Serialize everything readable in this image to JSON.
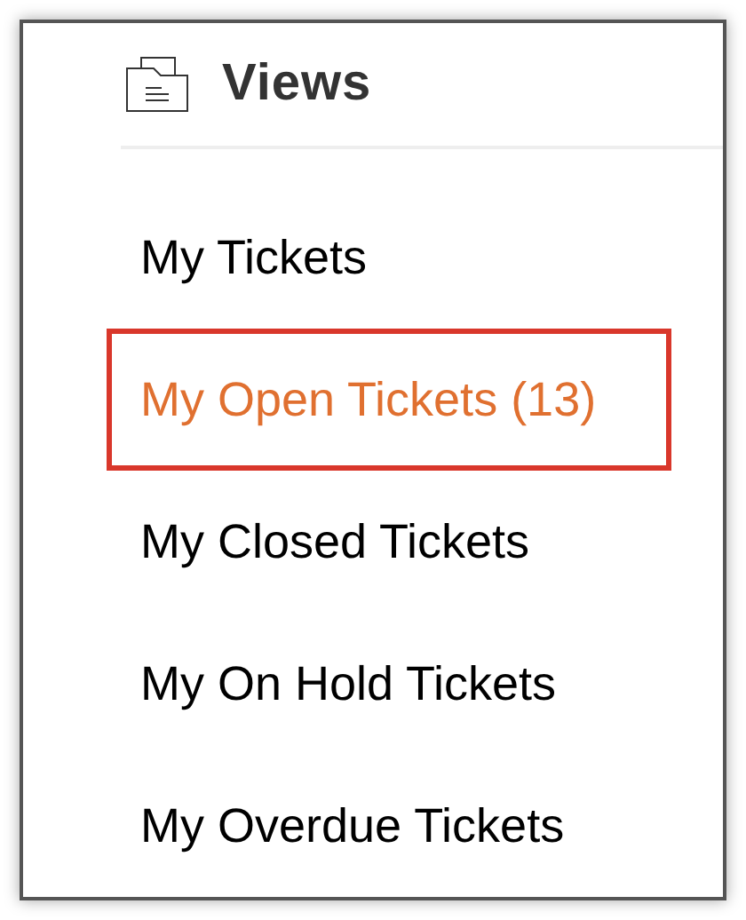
{
  "header": {
    "title": "Views"
  },
  "views": [
    {
      "label": "My Tickets",
      "selected": false
    },
    {
      "label": "My Open Tickets (13)",
      "selected": true
    },
    {
      "label": "My Closed Tickets",
      "selected": false
    },
    {
      "label": "My On Hold Tickets",
      "selected": false
    },
    {
      "label": "My Overdue Tickets",
      "selected": false
    }
  ]
}
